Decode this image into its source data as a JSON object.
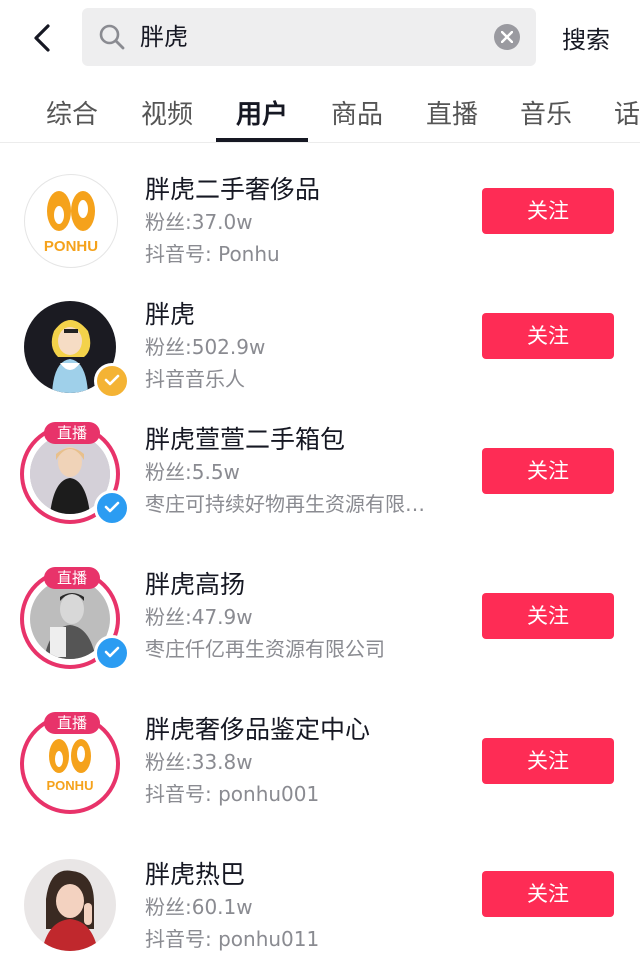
{
  "search": {
    "query": "胖虎",
    "submit_label": "搜索"
  },
  "tabs": [
    {
      "label": "综合"
    },
    {
      "label": "视频"
    },
    {
      "label": "用户",
      "active": true
    },
    {
      "label": "商品"
    },
    {
      "label": "直播"
    },
    {
      "label": "音乐"
    },
    {
      "label": "话"
    }
  ],
  "colors": {
    "accent": "#fe2c55",
    "live": "#e8336a",
    "verified_yellow": "#f4b334",
    "verified_blue": "#2b9cf2"
  },
  "users": [
    {
      "name": "胖虎二手奢侈品",
      "fans": "粉丝:37.0w",
      "detail": "抖音号: Ponhu",
      "follow_label": "关注",
      "avatar": "ponhu-logo",
      "live": false,
      "verified": "none",
      "logo_text": "PONHU"
    },
    {
      "name": "胖虎",
      "fans": "粉丝:502.9w",
      "detail": "抖音音乐人",
      "follow_label": "关注",
      "avatar": "cartoon",
      "live": false,
      "verified": "yellow"
    },
    {
      "name": "胖虎萱萱二手箱包",
      "fans": "粉丝:5.5w",
      "detail": "枣庄可持续好物再生资源有限…",
      "follow_label": "关注",
      "avatar": "photo-woman",
      "live": true,
      "live_label": "直播",
      "verified": "blue"
    },
    {
      "name": "胖虎高扬",
      "fans": "粉丝:47.9w",
      "detail": "枣庄仟亿再生资源有限公司",
      "follow_label": "关注",
      "avatar": "photo-man",
      "live": true,
      "live_label": "直播",
      "verified": "blue"
    },
    {
      "name": "胖虎奢侈品鉴定中心",
      "fans": "粉丝:33.8w",
      "detail": "抖音号: ponhu001",
      "follow_label": "关注",
      "avatar": "ponhu-logo",
      "live": true,
      "live_label": "直播",
      "verified": "none",
      "logo_text": "PONHU"
    },
    {
      "name": "胖虎热巴",
      "fans": "粉丝:60.1w",
      "detail": "抖音号: ponhu011",
      "follow_label": "关注",
      "avatar": "photo-portrait",
      "live": false,
      "verified": "none"
    }
  ]
}
